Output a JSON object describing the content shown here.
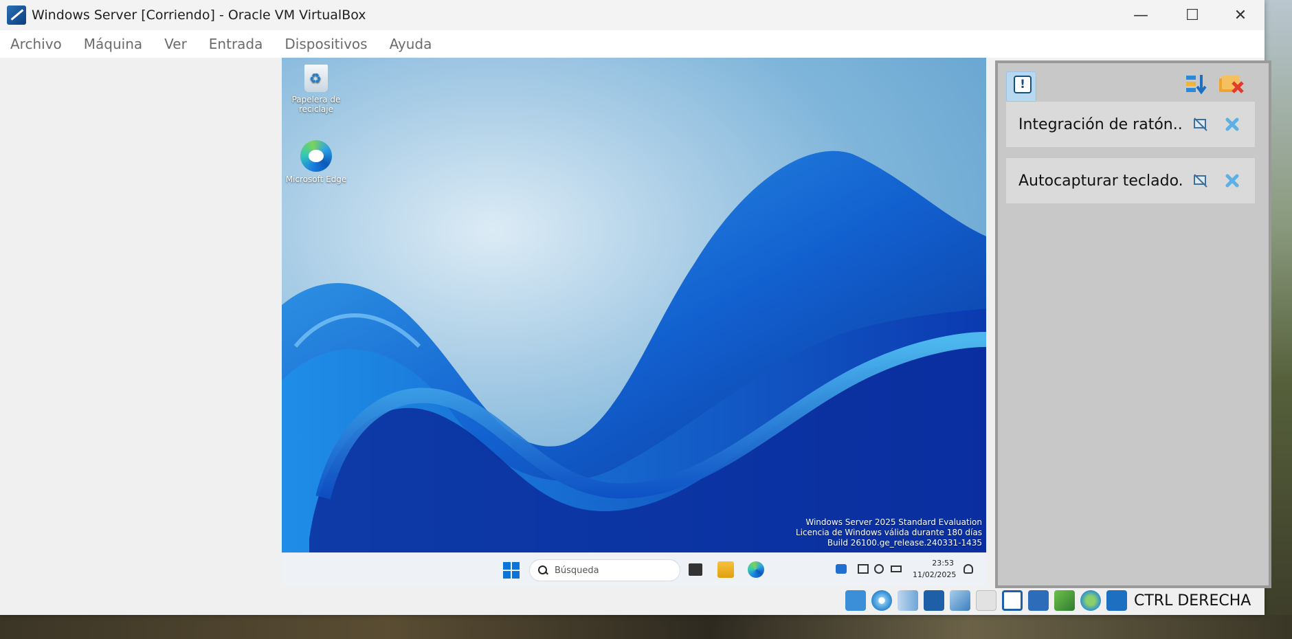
{
  "window": {
    "title": "Windows Server [Corriendo] - Oracle VM VirtualBox",
    "minimize": "—",
    "maximize": "☐",
    "close": "✕"
  },
  "menu": [
    "Archivo",
    "Máquina",
    "Ver",
    "Entrada",
    "Dispositivos",
    "Ayuda"
  ],
  "desktop": {
    "icons": [
      {
        "label": "Papelera de reciclaje",
        "icon": "recycle-bin-icon"
      },
      {
        "label": "Microsoft Edge",
        "icon": "edge-icon"
      }
    ],
    "watermark": [
      "Windows Server 2025 Standard Evaluation",
      "Licencia de Windows válida durante 180 días",
      "Build 26100.ge_release.240331-1435"
    ]
  },
  "taskbar": {
    "search_placeholder": "Búsqueda",
    "time": "23:53",
    "date": "11/02/2025"
  },
  "notifications": {
    "items": [
      {
        "label": "Integración de ratón..."
      },
      {
        "label": "Autocapturar teclado..."
      }
    ]
  },
  "statusbar": {
    "host_key": "CTRL DERECHA"
  },
  "colors": {
    "accent": "#0a74d8",
    "panel_bg": "#c8c8c8",
    "card_bg": "#dadada"
  }
}
